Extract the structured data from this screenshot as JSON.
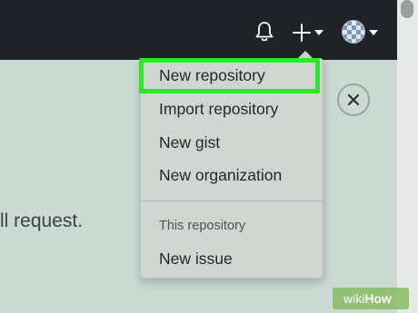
{
  "header": {
    "icons": [
      "bell-icon",
      "plus-icon",
      "caret-down-icon",
      "avatar",
      "caret-down-icon"
    ]
  },
  "background": {
    "partial_text": "ll request."
  },
  "dropdown": {
    "items": [
      {
        "label": "New repository",
        "highlighted": true
      },
      {
        "label": "Import repository"
      },
      {
        "label": "New gist"
      },
      {
        "label": "New organization"
      }
    ],
    "section_label": "This repository",
    "section_items": [
      {
        "label": "New issue"
      }
    ]
  },
  "close_button": {
    "icon": "close-icon"
  },
  "watermark": {
    "part1": "wiki",
    "part2": "How"
  },
  "colors": {
    "header_bg": "#1f2327",
    "page_bg": "#cad9d2",
    "menu_bg": "#d0d5d2",
    "highlight": "#2ce62a",
    "watermark_bg": "#8ebe68"
  }
}
